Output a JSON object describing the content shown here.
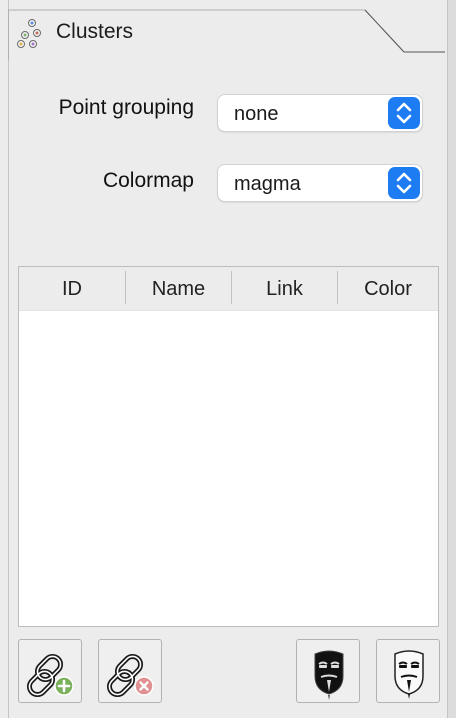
{
  "panel": {
    "title": "Clusters",
    "icon": "clusters-icon"
  },
  "form": {
    "point_grouping": {
      "label": "Point grouping",
      "value": "none"
    },
    "colormap": {
      "label": "Colormap",
      "value": "magma"
    }
  },
  "table": {
    "columns": [
      "ID",
      "Name",
      "Link",
      "Color"
    ],
    "rows": []
  },
  "toolbar": {
    "buttons": [
      {
        "icon": "link-add-icon"
      },
      {
        "icon": "link-remove-icon"
      },
      {
        "icon": "mask-black-icon"
      },
      {
        "icon": "mask-white-icon"
      }
    ]
  },
  "colors": {
    "accent": "#1d7cf2",
    "panel_bg": "#ececec"
  }
}
